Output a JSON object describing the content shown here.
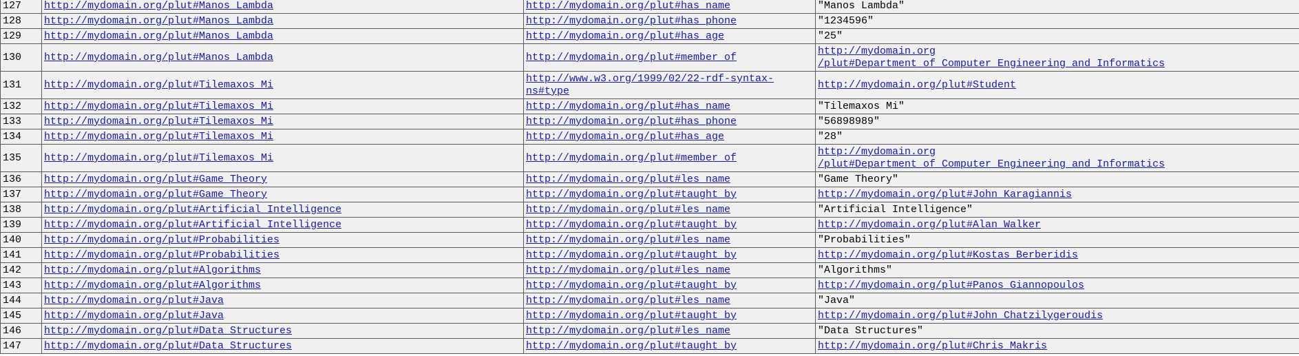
{
  "rows": [
    {
      "n": "127",
      "s": "http://mydomain.org/plut#Manos_Lambda",
      "p": "http://mydomain.org/plut#has_name",
      "o": "\"Manos Lambda\"",
      "o_uri": false
    },
    {
      "n": "128",
      "s": "http://mydomain.org/plut#Manos_Lambda",
      "p": "http://mydomain.org/plut#has_phone",
      "o": "\"1234596\"",
      "o_uri": false
    },
    {
      "n": "129",
      "s": "http://mydomain.org/plut#Manos_Lambda",
      "p": "http://mydomain.org/plut#has_age",
      "o": "\"25\"",
      "o_uri": false
    },
    {
      "n": "130",
      "s": "http://mydomain.org/plut#Manos_Lambda",
      "p": "http://mydomain.org/plut#member_of",
      "o": "http://mydomain.org\n/plut#Department_of_Computer_Engineering_and_Informatics",
      "o_uri": true
    },
    {
      "n": "131",
      "s": "http://mydomain.org/plut#Tilemaxos_Mi",
      "p": "http://www.w3.org/1999/02/22-rdf-syntax-\nns#type",
      "o": "http://mydomain.org/plut#Student",
      "o_uri": true
    },
    {
      "n": "132",
      "s": "http://mydomain.org/plut#Tilemaxos_Mi",
      "p": "http://mydomain.org/plut#has_name",
      "o": "\"Tilemaxos Mi\"",
      "o_uri": false
    },
    {
      "n": "133",
      "s": "http://mydomain.org/plut#Tilemaxos_Mi",
      "p": "http://mydomain.org/plut#has_phone",
      "o": "\"56898989\"",
      "o_uri": false
    },
    {
      "n": "134",
      "s": "http://mydomain.org/plut#Tilemaxos_Mi",
      "p": "http://mydomain.org/plut#has_age",
      "o": "\"28\"",
      "o_uri": false
    },
    {
      "n": "135",
      "s": "http://mydomain.org/plut#Tilemaxos_Mi",
      "p": "http://mydomain.org/plut#member_of",
      "o": "http://mydomain.org\n/plut#Department_of_Computer_Engineering_and_Informatics",
      "o_uri": true
    },
    {
      "n": "136",
      "s": "http://mydomain.org/plut#Game_Theory",
      "p": "http://mydomain.org/plut#les_name",
      "o": "\"Game Theory\"",
      "o_uri": false
    },
    {
      "n": "137",
      "s": "http://mydomain.org/plut#Game_Theory",
      "p": "http://mydomain.org/plut#taught_by",
      "o": "http://mydomain.org/plut#John_Karagiannis",
      "o_uri": true
    },
    {
      "n": "138",
      "s": "http://mydomain.org/plut#Artificial_Intelligence",
      "p": "http://mydomain.org/plut#les_name",
      "o": "\"Artificial Intelligence\"",
      "o_uri": false
    },
    {
      "n": "139",
      "s": "http://mydomain.org/plut#Artificial_Intelligence",
      "p": "http://mydomain.org/plut#taught_by",
      "o": "http://mydomain.org/plut#Alan_Walker",
      "o_uri": true
    },
    {
      "n": "140",
      "s": "http://mydomain.org/plut#Probabilities",
      "p": "http://mydomain.org/plut#les_name",
      "o": "\"Probabilities\"",
      "o_uri": false
    },
    {
      "n": "141",
      "s": "http://mydomain.org/plut#Probabilities",
      "p": "http://mydomain.org/plut#taught_by",
      "o": "http://mydomain.org/plut#Kostas_Berberidis",
      "o_uri": true
    },
    {
      "n": "142",
      "s": "http://mydomain.org/plut#Algorithms",
      "p": "http://mydomain.org/plut#les_name",
      "o": "\"Algorithms\"",
      "o_uri": false
    },
    {
      "n": "143",
      "s": "http://mydomain.org/plut#Algorithms",
      "p": "http://mydomain.org/plut#taught_by",
      "o": "http://mydomain.org/plut#Panos_Giannopoulos",
      "o_uri": true
    },
    {
      "n": "144",
      "s": "http://mydomain.org/plut#Java",
      "p": "http://mydomain.org/plut#les_name",
      "o": "\"Java\"",
      "o_uri": false
    },
    {
      "n": "145",
      "s": "http://mydomain.org/plut#Java",
      "p": "http://mydomain.org/plut#taught_by",
      "o": "http://mydomain.org/plut#John_Chatzilygeroudis",
      "o_uri": true
    },
    {
      "n": "146",
      "s": "http://mydomain.org/plut#Data_Structures",
      "p": "http://mydomain.org/plut#les_name",
      "o": "\"Data Structures\"",
      "o_uri": false
    },
    {
      "n": "147",
      "s": "http://mydomain.org/plut#Data_Structures",
      "p": "http://mydomain.org/plut#taught_by",
      "o": "http://mydomain.org/plut#Chris_Makris",
      "o_uri": true
    }
  ],
  "colors": {
    "link": "#1a1aa6",
    "row_bg": "#f0f0f0",
    "border": "#5a5a5a"
  }
}
